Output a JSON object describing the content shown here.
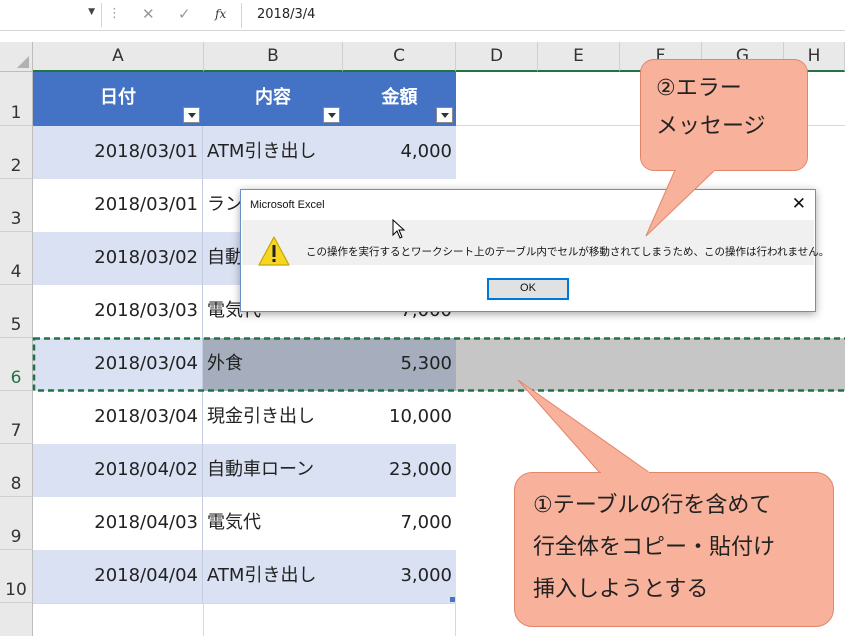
{
  "formula_bar": {
    "fx_label": "fx",
    "value": "2018/3/4",
    "cancel_glyph": "✕",
    "enter_glyph": "✓",
    "sep_glyph": "⋮"
  },
  "columns": [
    "A",
    "B",
    "C",
    "D",
    "E",
    "F",
    "G",
    "H"
  ],
  "row_numbers": [
    "1",
    "2",
    "3",
    "4",
    "5",
    "6",
    "7",
    "8",
    "9",
    "10"
  ],
  "table": {
    "headers": [
      "日付",
      "内容",
      "金額"
    ],
    "rows": [
      [
        "2018/03/01",
        "ATM引き出し",
        "4,000"
      ],
      [
        "2018/03/01",
        "ランチ",
        ""
      ],
      [
        "2018/03/02",
        "自動",
        ""
      ],
      [
        "2018/03/03",
        "電気代",
        "7,000"
      ],
      [
        "2018/03/04",
        "外食",
        "5,300"
      ],
      [
        "2018/03/04",
        "現金引き出し",
        "10,000"
      ],
      [
        "2018/04/02",
        "自動車ローン",
        "23,000"
      ],
      [
        "2018/04/03",
        "電気代",
        "7,000"
      ],
      [
        "2018/04/04",
        "ATM引き出し",
        "3,000"
      ]
    ],
    "colors": {
      "header": "#4472c4",
      "band": "#d9e1f2",
      "selected": "#a6adbd",
      "selected_row": "#c6c6c6"
    }
  },
  "dialog": {
    "title": "Microsoft Excel",
    "message": "この操作を実行するとワークシート上のテーブル内でセルが移動されてしまうため、この操作は行われません。",
    "ok_label": "OK",
    "close_glyph": "✕"
  },
  "callouts": {
    "error": [
      "②エラー",
      "メッセージ"
    ],
    "action": [
      "①テーブルの行を含めて",
      "行全体をコピー・貼付け",
      "挿入しようとする"
    ]
  }
}
